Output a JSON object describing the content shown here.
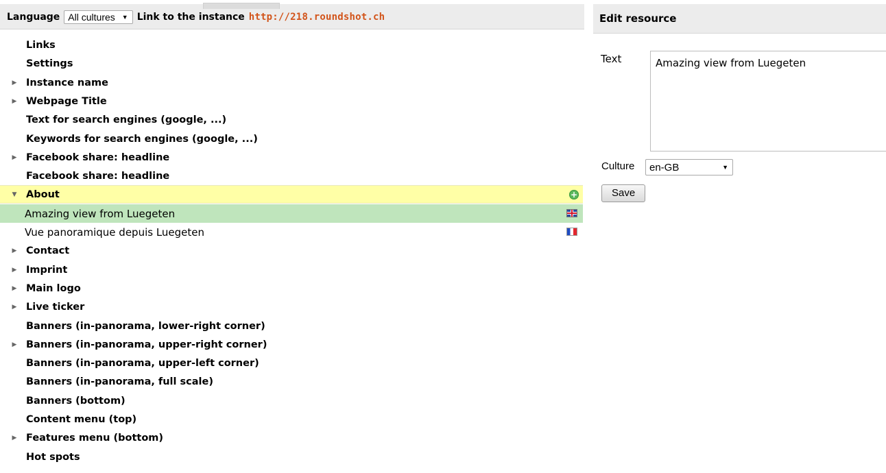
{
  "toolbar": {
    "language_label": "Language",
    "language_value": "All cultures",
    "link_label": "Link to the instance",
    "link_url": "http://218.roundshot.ch"
  },
  "tree": {
    "items": [
      {
        "label": "Links",
        "expandable": false
      },
      {
        "label": "Settings",
        "expandable": false
      },
      {
        "label": "Instance name",
        "expandable": true
      },
      {
        "label": "Webpage Title",
        "expandable": true
      },
      {
        "label": "Text for search engines (google, ...)",
        "expandable": false
      },
      {
        "label": "Keywords for search engines (google, ...)",
        "expandable": false
      },
      {
        "label": "Facebook share: headline",
        "expandable": true
      },
      {
        "label": "Facebook share: headline",
        "expandable": false
      },
      {
        "label": "About",
        "expandable": true,
        "expanded": true
      },
      {
        "label": "Amazing view from Luegeten",
        "child": true,
        "selected": true,
        "flag": "gb-flag-icon"
      },
      {
        "label": "Vue panoramique depuis Luegeten",
        "child": true,
        "flag": "fr-flag-icon"
      },
      {
        "label": "Contact",
        "expandable": true
      },
      {
        "label": "Imprint",
        "expandable": true
      },
      {
        "label": "Main logo",
        "expandable": true
      },
      {
        "label": "Live ticker",
        "expandable": true
      },
      {
        "label": "Banners (in-panorama, lower-right corner)",
        "expandable": false
      },
      {
        "label": "Banners (in-panorama, upper-right corner)",
        "expandable": true
      },
      {
        "label": "Banners (in-panorama, upper-left corner)",
        "expandable": false
      },
      {
        "label": "Banners (in-panorama, full scale)",
        "expandable": false
      },
      {
        "label": "Banners (bottom)",
        "expandable": false
      },
      {
        "label": "Content menu (top)",
        "expandable": false
      },
      {
        "label": "Features menu (bottom)",
        "expandable": true
      },
      {
        "label": "Hot spots",
        "expandable": false
      }
    ]
  },
  "editor": {
    "title": "Edit resource",
    "text_label": "Text",
    "text_value": "Amazing view from Luegeten",
    "culture_label": "Culture",
    "culture_value": "en-GB",
    "save_label": "Save"
  },
  "colors": {
    "link_url": "#d2541a",
    "section_highlight": "#ffffa6",
    "selected_row": "#bfe5bc",
    "header_bg": "#ececec"
  }
}
